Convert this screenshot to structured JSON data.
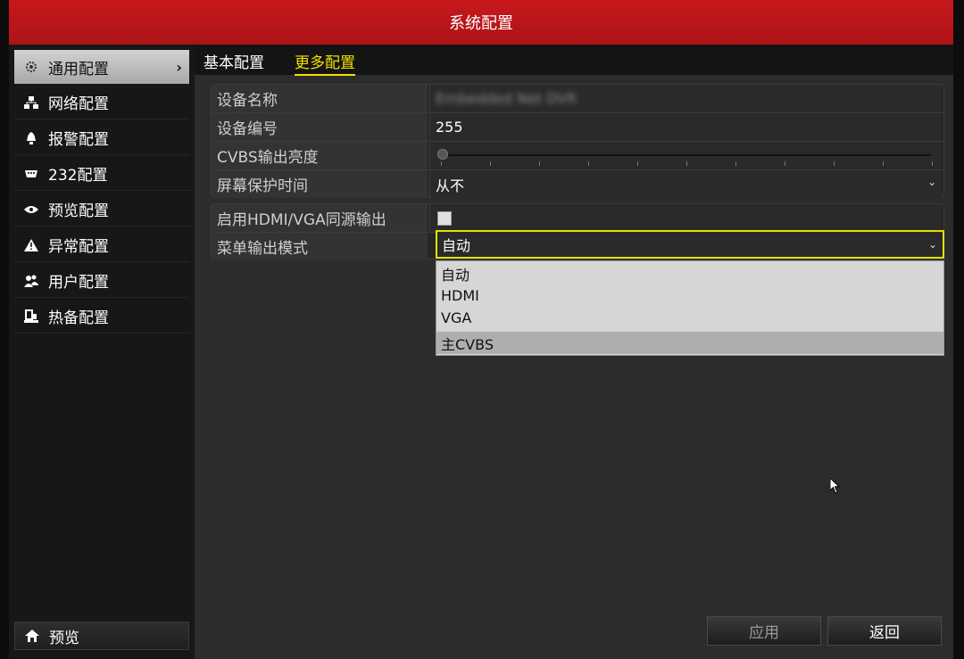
{
  "window": {
    "title": "系统配置"
  },
  "sidebar": {
    "items": [
      {
        "label": "通用配置",
        "icon": "gear-icon",
        "active": true
      },
      {
        "label": "网络配置",
        "icon": "network-icon"
      },
      {
        "label": "报警配置",
        "icon": "alarm-bell-icon"
      },
      {
        "label": "232配置",
        "icon": "serial-port-icon"
      },
      {
        "label": "预览配置",
        "icon": "eye-icon"
      },
      {
        "label": "异常配置",
        "icon": "warning-icon"
      },
      {
        "label": "用户配置",
        "icon": "users-icon"
      },
      {
        "label": "热备配置",
        "icon": "hot-backup-icon"
      }
    ],
    "preview_label": "预览",
    "preview_icon": "home-icon"
  },
  "tabs": [
    {
      "label": "基本配置",
      "active": false
    },
    {
      "label": "更多配置",
      "active": true
    }
  ],
  "form": {
    "device_name_label": "设备名称",
    "device_name_value": "Embedded Net DVR",
    "device_no_label": "设备编号",
    "device_no_value": "255",
    "cvbs_brightness_label": "CVBS输出亮度",
    "cvbs_brightness_level": 0,
    "screensaver_label": "屏幕保护时间",
    "screensaver_value": "从不",
    "hdmi_vga_label": "启用HDMI/VGA同源输出",
    "hdmi_vga_checked": false,
    "menu_output_label": "菜单输出模式",
    "menu_output_value": "自动"
  },
  "dropdown": {
    "options": [
      "自动",
      "HDMI",
      "VGA",
      "主CVBS"
    ],
    "hover_index": 3
  },
  "buttons": {
    "apply": "应用",
    "back": "返回"
  },
  "colors": {
    "title_bar": "#c0161a",
    "highlight": "#f0e000"
  }
}
